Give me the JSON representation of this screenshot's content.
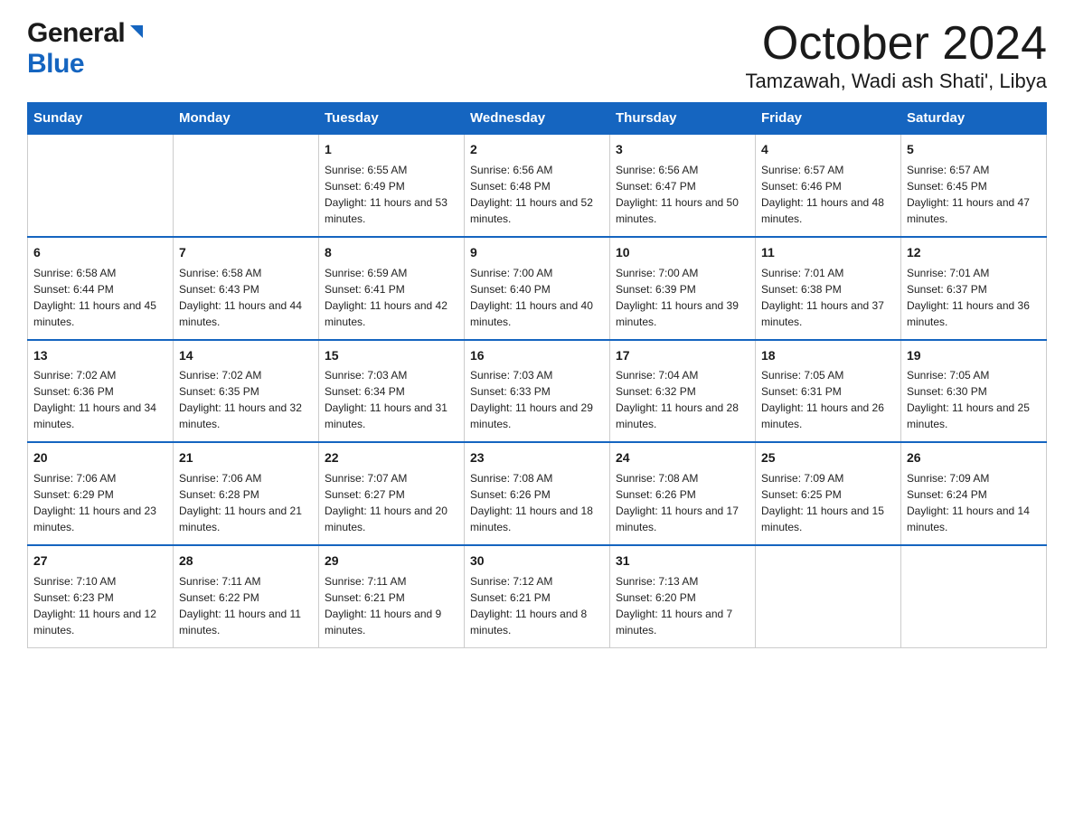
{
  "header": {
    "logo_general": "General",
    "logo_blue": "Blue",
    "month_title": "October 2024",
    "location": "Tamzawah, Wadi ash Shati', Libya"
  },
  "weekdays": [
    "Sunday",
    "Monday",
    "Tuesday",
    "Wednesday",
    "Thursday",
    "Friday",
    "Saturday"
  ],
  "weeks": [
    [
      {
        "day": "",
        "sunrise": "",
        "sunset": "",
        "daylight": ""
      },
      {
        "day": "",
        "sunrise": "",
        "sunset": "",
        "daylight": ""
      },
      {
        "day": "1",
        "sunrise": "Sunrise: 6:55 AM",
        "sunset": "Sunset: 6:49 PM",
        "daylight": "Daylight: 11 hours and 53 minutes."
      },
      {
        "day": "2",
        "sunrise": "Sunrise: 6:56 AM",
        "sunset": "Sunset: 6:48 PM",
        "daylight": "Daylight: 11 hours and 52 minutes."
      },
      {
        "day": "3",
        "sunrise": "Sunrise: 6:56 AM",
        "sunset": "Sunset: 6:47 PM",
        "daylight": "Daylight: 11 hours and 50 minutes."
      },
      {
        "day": "4",
        "sunrise": "Sunrise: 6:57 AM",
        "sunset": "Sunset: 6:46 PM",
        "daylight": "Daylight: 11 hours and 48 minutes."
      },
      {
        "day": "5",
        "sunrise": "Sunrise: 6:57 AM",
        "sunset": "Sunset: 6:45 PM",
        "daylight": "Daylight: 11 hours and 47 minutes."
      }
    ],
    [
      {
        "day": "6",
        "sunrise": "Sunrise: 6:58 AM",
        "sunset": "Sunset: 6:44 PM",
        "daylight": "Daylight: 11 hours and 45 minutes."
      },
      {
        "day": "7",
        "sunrise": "Sunrise: 6:58 AM",
        "sunset": "Sunset: 6:43 PM",
        "daylight": "Daylight: 11 hours and 44 minutes."
      },
      {
        "day": "8",
        "sunrise": "Sunrise: 6:59 AM",
        "sunset": "Sunset: 6:41 PM",
        "daylight": "Daylight: 11 hours and 42 minutes."
      },
      {
        "day": "9",
        "sunrise": "Sunrise: 7:00 AM",
        "sunset": "Sunset: 6:40 PM",
        "daylight": "Daylight: 11 hours and 40 minutes."
      },
      {
        "day": "10",
        "sunrise": "Sunrise: 7:00 AM",
        "sunset": "Sunset: 6:39 PM",
        "daylight": "Daylight: 11 hours and 39 minutes."
      },
      {
        "day": "11",
        "sunrise": "Sunrise: 7:01 AM",
        "sunset": "Sunset: 6:38 PM",
        "daylight": "Daylight: 11 hours and 37 minutes."
      },
      {
        "day": "12",
        "sunrise": "Sunrise: 7:01 AM",
        "sunset": "Sunset: 6:37 PM",
        "daylight": "Daylight: 11 hours and 36 minutes."
      }
    ],
    [
      {
        "day": "13",
        "sunrise": "Sunrise: 7:02 AM",
        "sunset": "Sunset: 6:36 PM",
        "daylight": "Daylight: 11 hours and 34 minutes."
      },
      {
        "day": "14",
        "sunrise": "Sunrise: 7:02 AM",
        "sunset": "Sunset: 6:35 PM",
        "daylight": "Daylight: 11 hours and 32 minutes."
      },
      {
        "day": "15",
        "sunrise": "Sunrise: 7:03 AM",
        "sunset": "Sunset: 6:34 PM",
        "daylight": "Daylight: 11 hours and 31 minutes."
      },
      {
        "day": "16",
        "sunrise": "Sunrise: 7:03 AM",
        "sunset": "Sunset: 6:33 PM",
        "daylight": "Daylight: 11 hours and 29 minutes."
      },
      {
        "day": "17",
        "sunrise": "Sunrise: 7:04 AM",
        "sunset": "Sunset: 6:32 PM",
        "daylight": "Daylight: 11 hours and 28 minutes."
      },
      {
        "day": "18",
        "sunrise": "Sunrise: 7:05 AM",
        "sunset": "Sunset: 6:31 PM",
        "daylight": "Daylight: 11 hours and 26 minutes."
      },
      {
        "day": "19",
        "sunrise": "Sunrise: 7:05 AM",
        "sunset": "Sunset: 6:30 PM",
        "daylight": "Daylight: 11 hours and 25 minutes."
      }
    ],
    [
      {
        "day": "20",
        "sunrise": "Sunrise: 7:06 AM",
        "sunset": "Sunset: 6:29 PM",
        "daylight": "Daylight: 11 hours and 23 minutes."
      },
      {
        "day": "21",
        "sunrise": "Sunrise: 7:06 AM",
        "sunset": "Sunset: 6:28 PM",
        "daylight": "Daylight: 11 hours and 21 minutes."
      },
      {
        "day": "22",
        "sunrise": "Sunrise: 7:07 AM",
        "sunset": "Sunset: 6:27 PM",
        "daylight": "Daylight: 11 hours and 20 minutes."
      },
      {
        "day": "23",
        "sunrise": "Sunrise: 7:08 AM",
        "sunset": "Sunset: 6:26 PM",
        "daylight": "Daylight: 11 hours and 18 minutes."
      },
      {
        "day": "24",
        "sunrise": "Sunrise: 7:08 AM",
        "sunset": "Sunset: 6:26 PM",
        "daylight": "Daylight: 11 hours and 17 minutes."
      },
      {
        "day": "25",
        "sunrise": "Sunrise: 7:09 AM",
        "sunset": "Sunset: 6:25 PM",
        "daylight": "Daylight: 11 hours and 15 minutes."
      },
      {
        "day": "26",
        "sunrise": "Sunrise: 7:09 AM",
        "sunset": "Sunset: 6:24 PM",
        "daylight": "Daylight: 11 hours and 14 minutes."
      }
    ],
    [
      {
        "day": "27",
        "sunrise": "Sunrise: 7:10 AM",
        "sunset": "Sunset: 6:23 PM",
        "daylight": "Daylight: 11 hours and 12 minutes."
      },
      {
        "day": "28",
        "sunrise": "Sunrise: 7:11 AM",
        "sunset": "Sunset: 6:22 PM",
        "daylight": "Daylight: 11 hours and 11 minutes."
      },
      {
        "day": "29",
        "sunrise": "Sunrise: 7:11 AM",
        "sunset": "Sunset: 6:21 PM",
        "daylight": "Daylight: 11 hours and 9 minutes."
      },
      {
        "day": "30",
        "sunrise": "Sunrise: 7:12 AM",
        "sunset": "Sunset: 6:21 PM",
        "daylight": "Daylight: 11 hours and 8 minutes."
      },
      {
        "day": "31",
        "sunrise": "Sunrise: 7:13 AM",
        "sunset": "Sunset: 6:20 PM",
        "daylight": "Daylight: 11 hours and 7 minutes."
      },
      {
        "day": "",
        "sunrise": "",
        "sunset": "",
        "daylight": ""
      },
      {
        "day": "",
        "sunrise": "",
        "sunset": "",
        "daylight": ""
      }
    ]
  ]
}
